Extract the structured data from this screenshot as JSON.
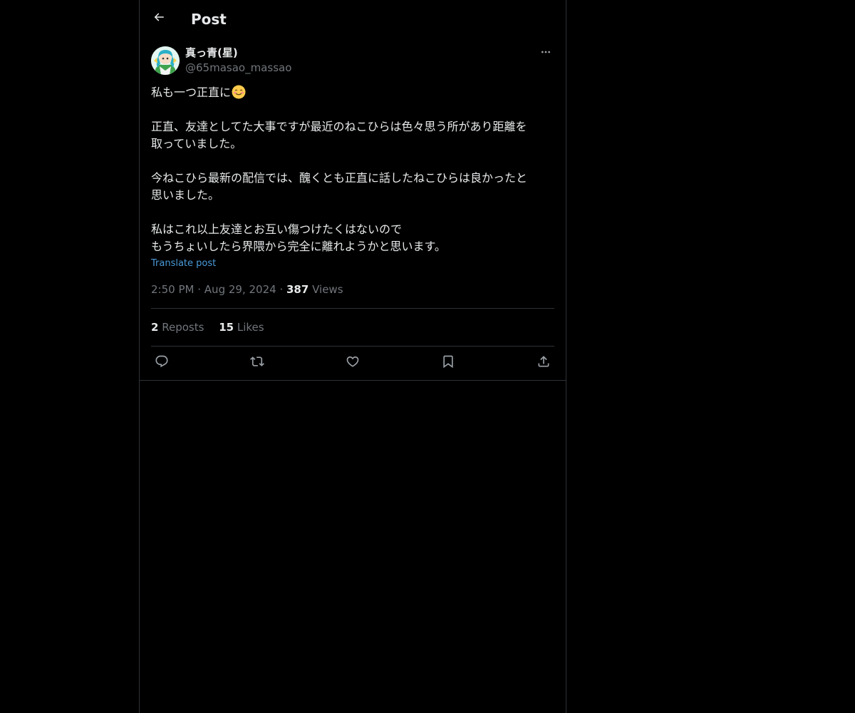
{
  "header": {
    "title": "Post",
    "back_icon": "arrow-left-icon"
  },
  "tweet": {
    "author": {
      "display_name": "真っ青(星)",
      "handle": "@65masao_massao"
    },
    "body": {
      "line1": "私も一つ正直に",
      "line1_emoji": "smiling-face-emoji",
      "line2": "正直、友達としてた大事ですが最近のねこひらは色々思う所があり距離を",
      "line3": "取っていました。",
      "line4": "今ねこひら最新の配信では、醜くとも正直に話したねこひらは良かったと",
      "line5": "思いました。",
      "line6": "私はこれ以上友達とお互い傷つけたくはないので",
      "line7": "もうちょいしたら界隈から完全に離れようかと思います。"
    },
    "translate_label": "Translate post",
    "meta": {
      "time": "2:50 PM",
      "separator": "·",
      "date": "Aug 29, 2024",
      "views_count": "387",
      "views_label": "Views"
    },
    "stats": {
      "reposts_count": "2",
      "reposts_label": "Reposts",
      "likes_count": "15",
      "likes_label": "Likes"
    },
    "actions": [
      "reply-icon",
      "repost-icon",
      "like-icon",
      "bookmark-icon",
      "share-icon"
    ]
  },
  "colors": {
    "background": "#000000",
    "text": "#e7e9ea",
    "secondary_text": "#71767b",
    "link": "#4a9ad9",
    "border": "#2f3336"
  }
}
